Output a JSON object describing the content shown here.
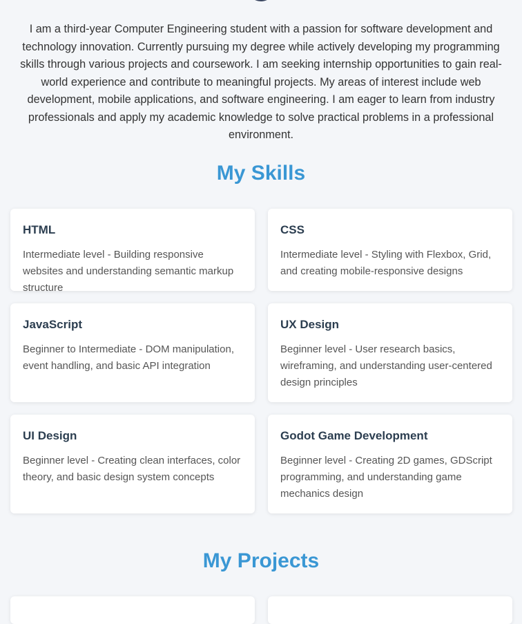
{
  "about": {
    "text": "I am a third-year Computer Engineering student with a passion for software development and technology innovation. Currently pursuing my degree while actively developing my programming skills through various projects and coursework. I am seeking internship opportunities to gain real-world experience and contribute to meaningful projects. My areas of interest include web development, mobile applications, and software engineering. I am eager to learn from industry professionals and apply my academic knowledge to solve practical problems in a professional environment."
  },
  "skills": {
    "title": "My Skills",
    "items": [
      {
        "name": "HTML",
        "description": "Intermediate level - Building responsive websites and understanding semantic markup structure"
      },
      {
        "name": "CSS",
        "description": "Intermediate level - Styling with Flexbox, Grid, and creating mobile-responsive designs"
      },
      {
        "name": "JavaScript",
        "description": "Beginner to Intermediate - DOM manipulation, event handling, and basic API integration"
      },
      {
        "name": "UX Design",
        "description": "Beginner level - User research basics, wireframing, and understanding user-centered design principles"
      },
      {
        "name": "UI Design",
        "description": "Beginner level - Creating clean interfaces, color theory, and basic design system concepts"
      },
      {
        "name": "Godot Game Development",
        "description": "Beginner level - Creating 2D games, GDScript programming, and understanding game mechanics design"
      }
    ]
  },
  "projects": {
    "title": "My Projects"
  }
}
